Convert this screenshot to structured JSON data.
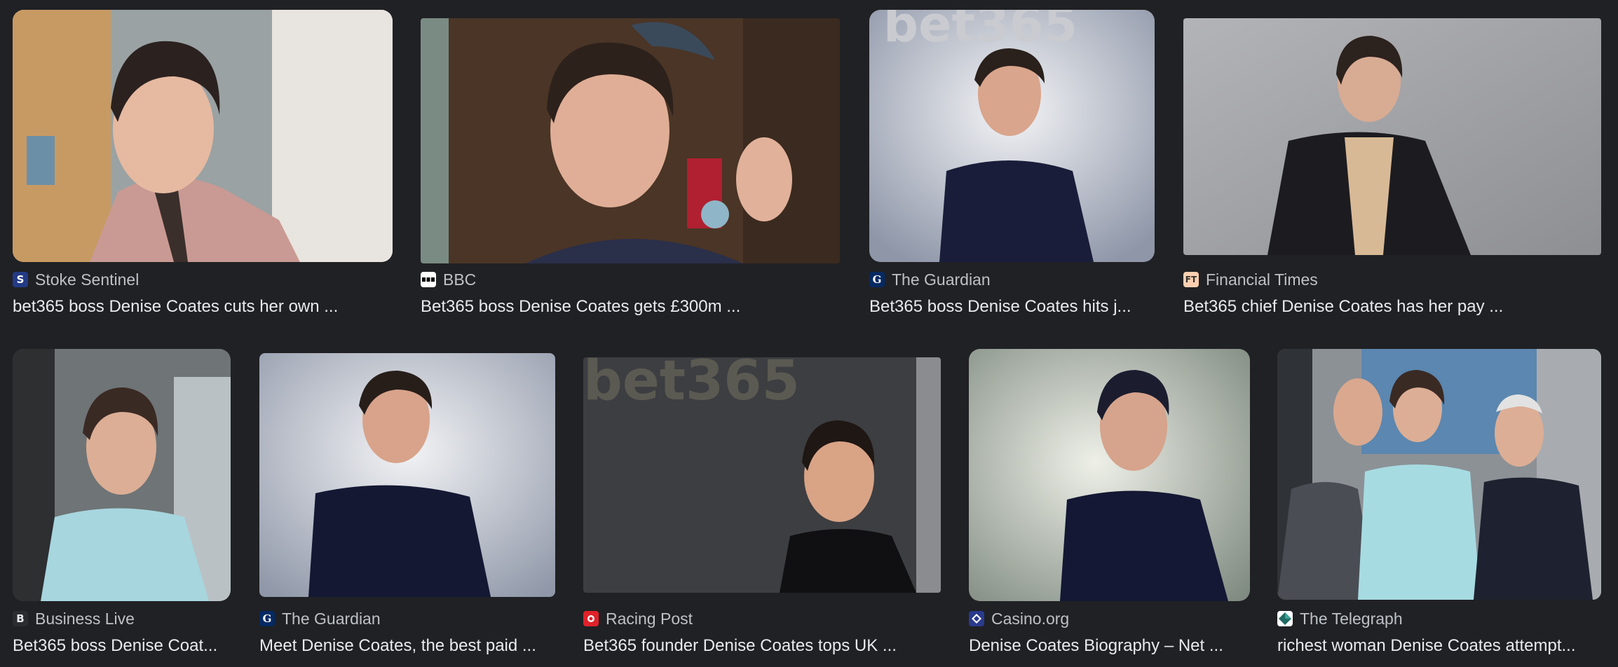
{
  "results": [
    {
      "source": "Stoke Sentinel",
      "favicon_icon": "stoke-sentinel-favicon-icon",
      "favicon_letter": "S",
      "title": "bet365 boss Denise Coates cuts her own ..."
    },
    {
      "source": "BBC",
      "favicon_icon": "bbc-favicon-icon",
      "favicon_letter": "",
      "title": "Bet365 boss Denise Coates gets £300m ..."
    },
    {
      "source": "The Guardian",
      "favicon_icon": "guardian-favicon-icon",
      "favicon_letter": "G",
      "title": "Bet365 boss Denise Coates hits j..."
    },
    {
      "source": "Financial Times",
      "favicon_icon": "ft-favicon-icon",
      "favicon_letter": "FT",
      "title": "Bet365 chief Denise Coates has her pay ..."
    },
    {
      "source": "Business Live",
      "favicon_icon": "business-live-favicon-icon",
      "favicon_letter": "B",
      "title": "Bet365 boss Denise Coat..."
    },
    {
      "source": "The Guardian",
      "favicon_icon": "guardian-favicon-icon",
      "favicon_letter": "G",
      "title": "Meet Denise Coates, the best paid ..."
    },
    {
      "source": "Racing Post",
      "favicon_icon": "racing-post-favicon-icon",
      "favicon_letter": "",
      "title": "Bet365 founder Denise Coates tops UK ..."
    },
    {
      "source": "Casino.org",
      "favicon_icon": "casino-org-favicon-icon",
      "favicon_letter": "",
      "title": "Denise Coates Biography – Net ..."
    },
    {
      "source": "The Telegraph",
      "favicon_icon": "telegraph-favicon-icon",
      "favicon_letter": "",
      "title": "richest woman Denise Coates attempt..."
    }
  ],
  "watermarks": {
    "bet365_top": "bet365",
    "bet365_bottom": "bet365"
  },
  "colors": {
    "background": "#202124",
    "source_text": "#bdc1c6",
    "title_text": "#e8eaed"
  }
}
